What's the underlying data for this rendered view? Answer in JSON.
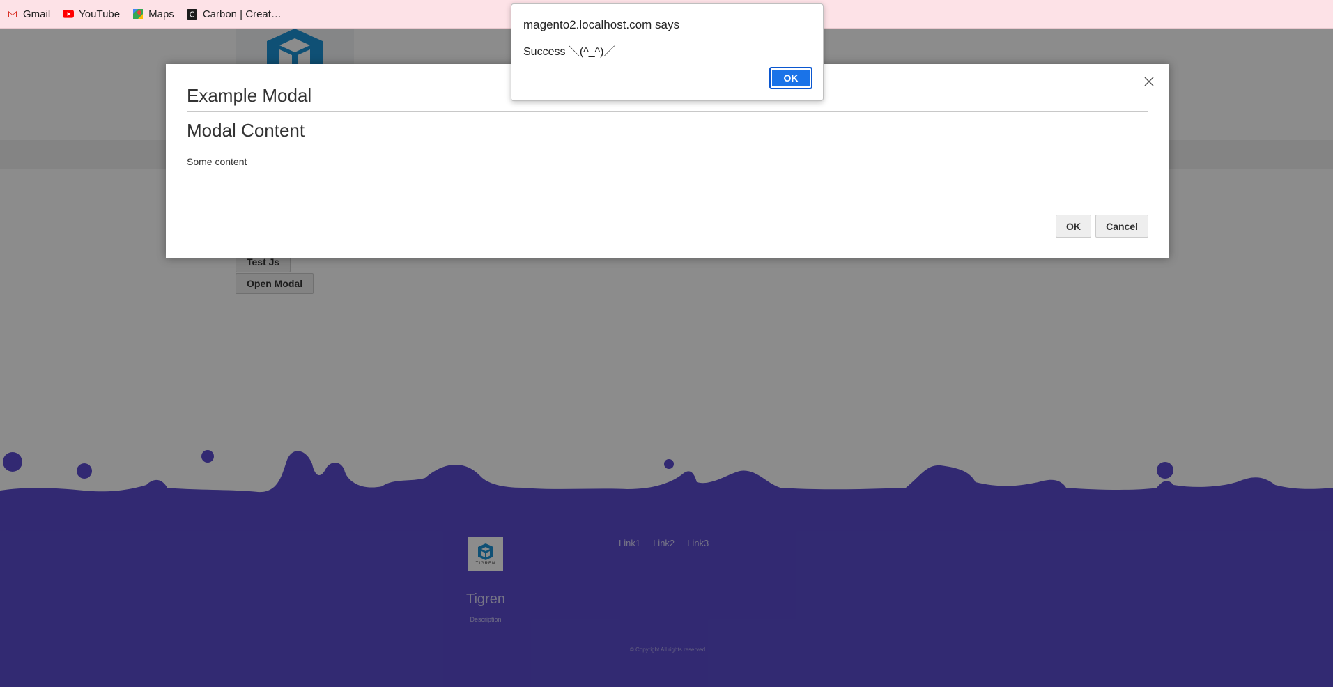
{
  "bookmarks": [
    {
      "label": "Gmail",
      "icon": "gmail-icon"
    },
    {
      "label": "YouTube",
      "icon": "youtube-icon"
    },
    {
      "label": "Maps",
      "icon": "maps-icon"
    },
    {
      "label": "Carbon | Creat…",
      "icon": "carbon-icon"
    }
  ],
  "page": {
    "buttons": {
      "test_js": "Test Js",
      "open_modal": "Open Modal"
    }
  },
  "footer": {
    "logo_text": "TIGREN",
    "title": "Tigren",
    "description": "Description",
    "links": [
      "Link1",
      "Link2",
      "Link3"
    ],
    "copyright": "© Copyright All rights reserved",
    "color": "#5b4ccf"
  },
  "modal": {
    "title": "Example Modal",
    "content_heading": "Modal Content",
    "content_text": "Some content",
    "ok_label": "OK",
    "cancel_label": "Cancel"
  },
  "alert": {
    "title": "magento2.localhost.com says",
    "message": "Success ＼(^_^)／",
    "ok_label": "OK"
  }
}
